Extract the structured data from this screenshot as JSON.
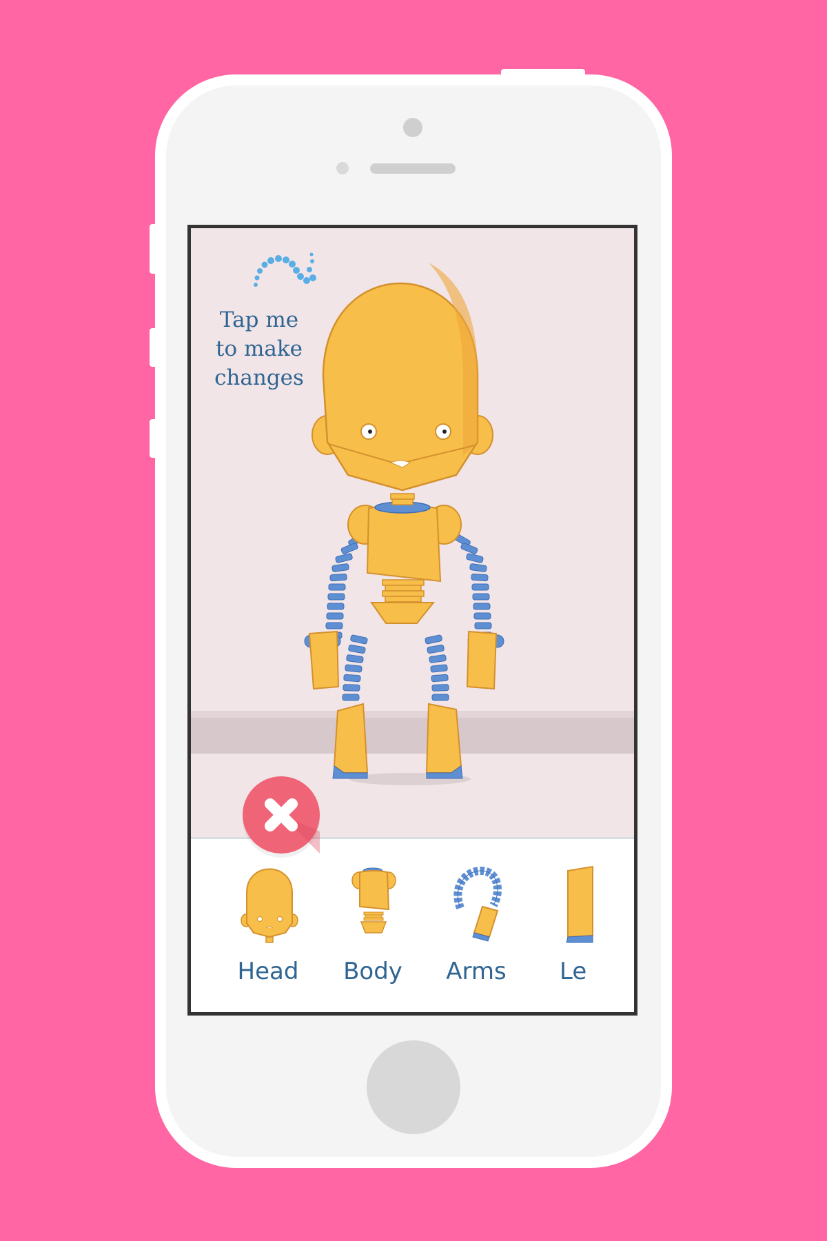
{
  "app": {
    "hint_lines": [
      "Tap me",
      "to make",
      "changes"
    ],
    "parts": [
      {
        "id": "head",
        "label": "Head"
      },
      {
        "id": "body",
        "label": "Body"
      },
      {
        "id": "arms",
        "label": "Arms"
      },
      {
        "id": "legs",
        "label": "Le"
      }
    ]
  },
  "icons": {
    "close": "close-x-icon",
    "hint": "dotted-arrow-icon"
  },
  "colors": {
    "background": "#ff66a3",
    "accent_text": "#2f6592",
    "robot_body": "#f7be4a",
    "robot_joint": "#5f8fd3",
    "close_button": "#f06478"
  }
}
